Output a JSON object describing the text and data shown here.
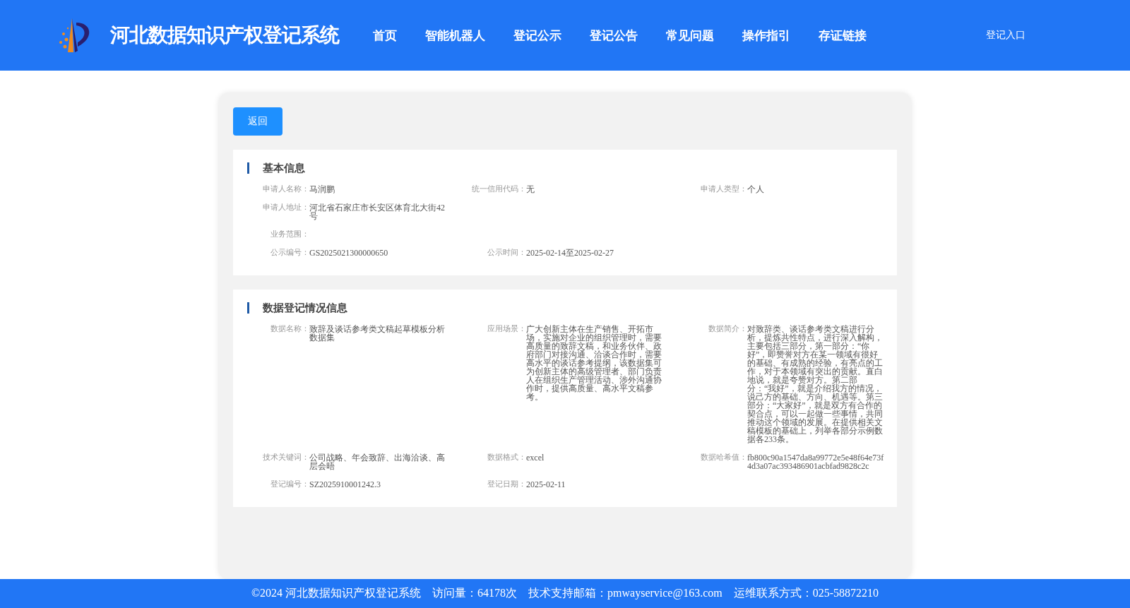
{
  "header": {
    "title": "河北数据知识产权登记系统",
    "nav": [
      {
        "label": "首页"
      },
      {
        "label": "智能机器人"
      },
      {
        "label": "登记公示"
      },
      {
        "label": "登记公告"
      },
      {
        "label": "常见问题"
      },
      {
        "label": "操作指引"
      },
      {
        "label": "存证链接"
      }
    ],
    "login": "登记入口"
  },
  "back_button": "返回",
  "sections": [
    {
      "title": "基本信息",
      "rows": [
        [
          {
            "label": "申请人名称：",
            "value": "马润鹏"
          },
          {
            "label": "统一信用代码：",
            "value": "无"
          },
          {
            "label": "申请人类型：",
            "value": "个人"
          }
        ],
        [
          {
            "label": "申请人地址：",
            "value": "河北省石家庄市长安区体育北大街42号"
          }
        ],
        [
          {
            "label": "业务范围："
          }
        ],
        [
          {
            "label": "公示编号：",
            "value": "GS2025021300000650"
          },
          {
            "label": "公示时间：",
            "value": "2025-02-14至2025-02-27"
          }
        ]
      ]
    },
    {
      "title": "数据登记情况信息",
      "rows": [
        [
          {
            "label": "数据名称：",
            "value": "致辞及谈话参考类文稿起草模板分析数据集"
          },
          {
            "label": "应用场景：",
            "value": "广大创新主体在生产销售、开拓市场，实施对企业的组织管理时，需要高质量的致辞文稿，和业务伙伴、政府部门对接沟通、洽谈合作时，需要高水平的谈话参考提纲，该数据集可为创新主体的高级管理者、部门负责人在组织生产管理活动、涉外沟通协作时，提供高质量、高水平文稿参考。"
          },
          {
            "label": "数据简介：",
            "value": "对致辞类、谈话参考类文稿进行分析，提炼共性特点，进行深入解构，主要包括三部分，第一部分：“你好”，即赞誉对方在某一领域有很好的基础、有成熟的经验，有亮点的工作，对于本领域有突出的贡献。直白地说，就是夸赞对方。第二部分：“我好”，就是介绍我方的情况，说己方的基础、方向、机遇等。第三部分：“大家好”，就是双方有合作的契合点，可以一起做一些事情，共同推动这个领域的发展。在提供相关文稿模板的基础上，列举各部分示例数据各233条。"
          }
        ],
        [
          {
            "label": "技术关键词：",
            "value": "公司战略、年会致辞、出海洽谈、高层会晤"
          },
          {
            "label": "数据格式：",
            "value": "excel"
          },
          {
            "label": "数据哈希值：",
            "value": "fb800c90a1547da8a99772e5e48f64e73f4d3a07ac393486901acbfad9828c2c"
          }
        ],
        [
          {
            "label": "登记编号：",
            "value": "SZ2025910001242.3"
          },
          {
            "label": "登记日期：",
            "value": "2025-02-11"
          }
        ]
      ]
    }
  ],
  "footer": [
    {
      "text": "©2024 河北数据知识产权登记系统"
    },
    {
      "text": "访问量：64178次"
    },
    {
      "text": "技术支持邮箱：pmwayservice@163.com"
    },
    {
      "text": "运维联系方式：025-58872210"
    }
  ]
}
